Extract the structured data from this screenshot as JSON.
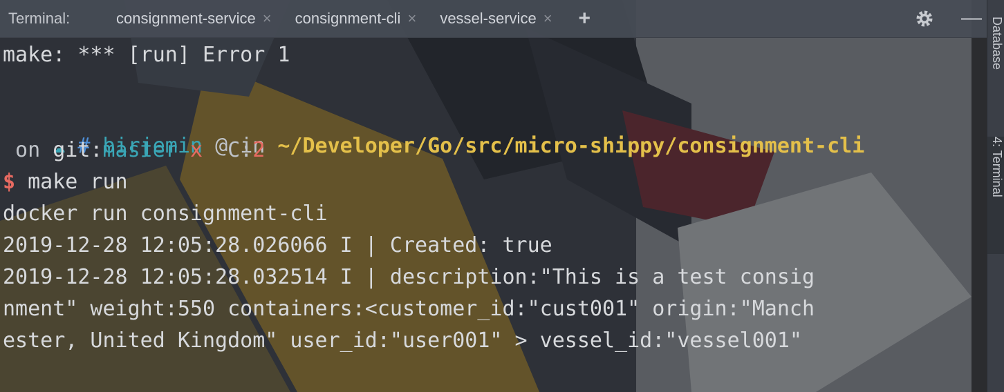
{
  "tabbar": {
    "title": "Terminal:",
    "tabs": [
      {
        "label": "consignment-service",
        "close": "×"
      },
      {
        "label": "consignment-cli",
        "close": "×"
      },
      {
        "label": "vessel-service",
        "close": "×"
      }
    ],
    "new_tab": "+",
    "settings_icon": "gear-icon",
    "minimize": "—"
  },
  "terminal": {
    "error_line": "make: *** [run] Error 1",
    "prompt": {
      "cloud": "☁",
      "hash": "#",
      "user": "birjemin",
      "at": "@",
      "in": "in",
      "path": "~/Developer/Go/src/micro-shippy/consignment-cli",
      "on": " on",
      "git_label": "git:",
      "branch": "master",
      "dirty": "x",
      "counter_label": "C:",
      "counter": "2",
      "dollar": "$",
      "command": "make run"
    },
    "output": [
      "docker run consignment-cli",
      "2019-12-28 12:05:28.026066 I | Created: true",
      "2019-12-28 12:05:28.032514 I | description:\"This is a test consig",
      "nment\" weight:550 containers:<customer_id:\"cust001\" origin:\"Manch",
      "ester, United Kingdom\" user_id:\"user001\" > vessel_id:\"vessel001\""
    ]
  },
  "side_strip": {
    "database": "Database",
    "terminal": "4: Terminal"
  },
  "colors": {
    "path": "#e4c04a",
    "user": "#3aa6b6",
    "branch": "#3aa6b6",
    "error": "#e76a61"
  }
}
